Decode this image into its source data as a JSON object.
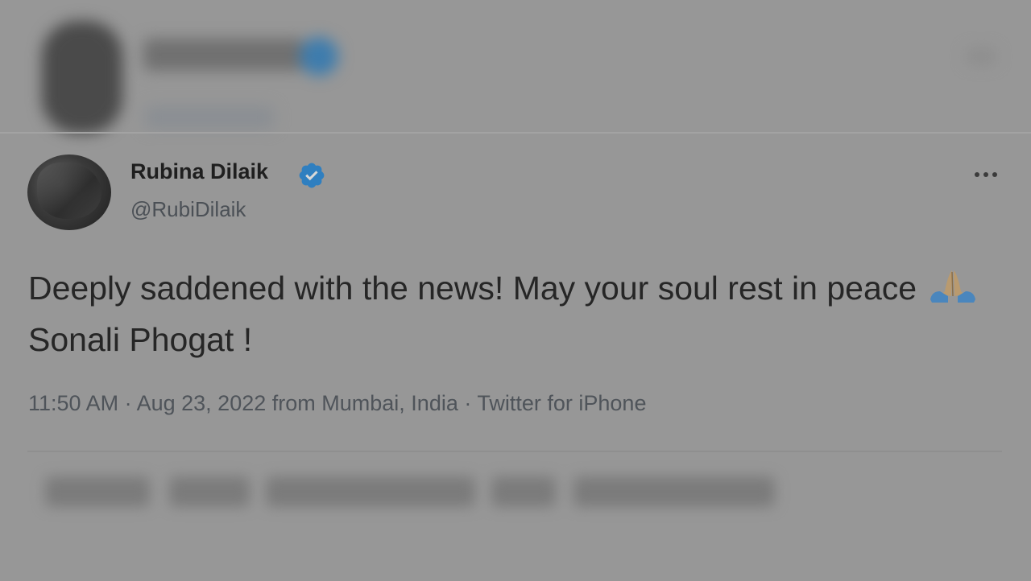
{
  "tweet": {
    "author": {
      "name": "Rubina Dilaik",
      "handle": "@RubiDilaik",
      "verified": true
    },
    "text_part1": "Deeply saddened with the news! May your soul rest in peace",
    "emoji": "folded-hands-icon",
    "text_part2": "Sonali Phogat !",
    "meta": {
      "time": "11:50 AM",
      "date": "Aug 23, 2022",
      "location": "from Mumbai, India",
      "source": "Twitter for iPhone",
      "separator": " · "
    }
  },
  "colors": {
    "verified": "#2f7fc0",
    "overlay_background": "#979797"
  }
}
